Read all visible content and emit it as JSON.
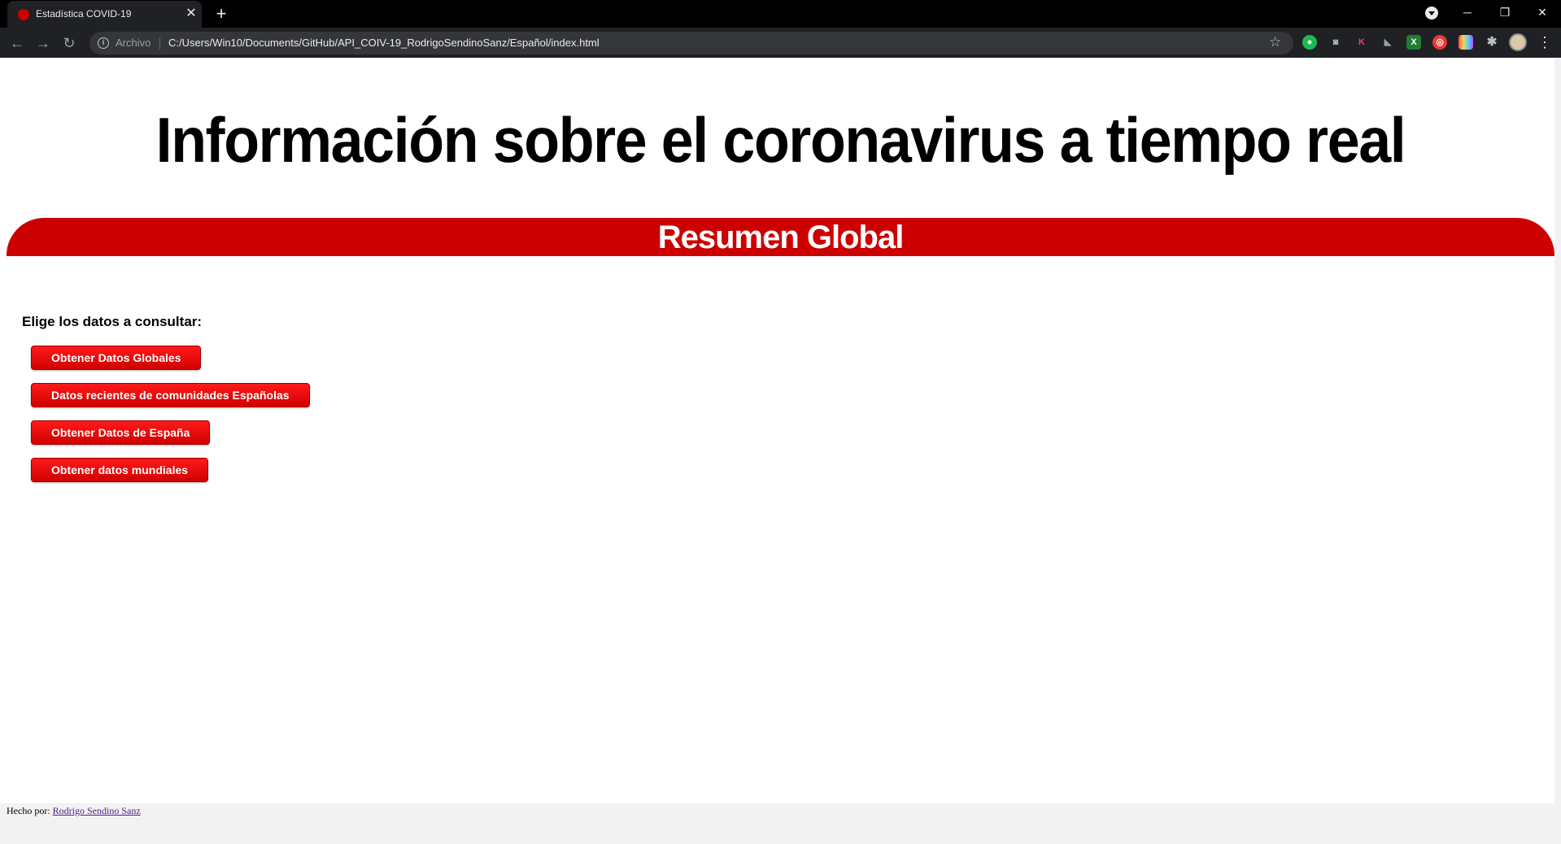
{
  "browser": {
    "tab_title": "Estadística COVID-19",
    "omnibox_label": "Archivo",
    "url": "C:/Users/Win10/Documents/GitHub/API_COIV-19_RodrigoSendinoSanz/Español/index.html"
  },
  "page": {
    "title": "Información sobre el coronavirus a tiempo real",
    "section_title": "Resumen Global",
    "prompt": "Elige los datos a consultar:",
    "buttons": [
      "Obtener Datos Globales",
      "Datos recientes de comunidades Españolas",
      "Obtener Datos de España",
      "Obtener datos mundiales"
    ],
    "footer_prefix": "Hecho por:",
    "footer_author": "Rodrigo Sendino Sanz"
  },
  "colors": {
    "accent_red": "#cc0000",
    "chrome_dark": "#202124"
  }
}
